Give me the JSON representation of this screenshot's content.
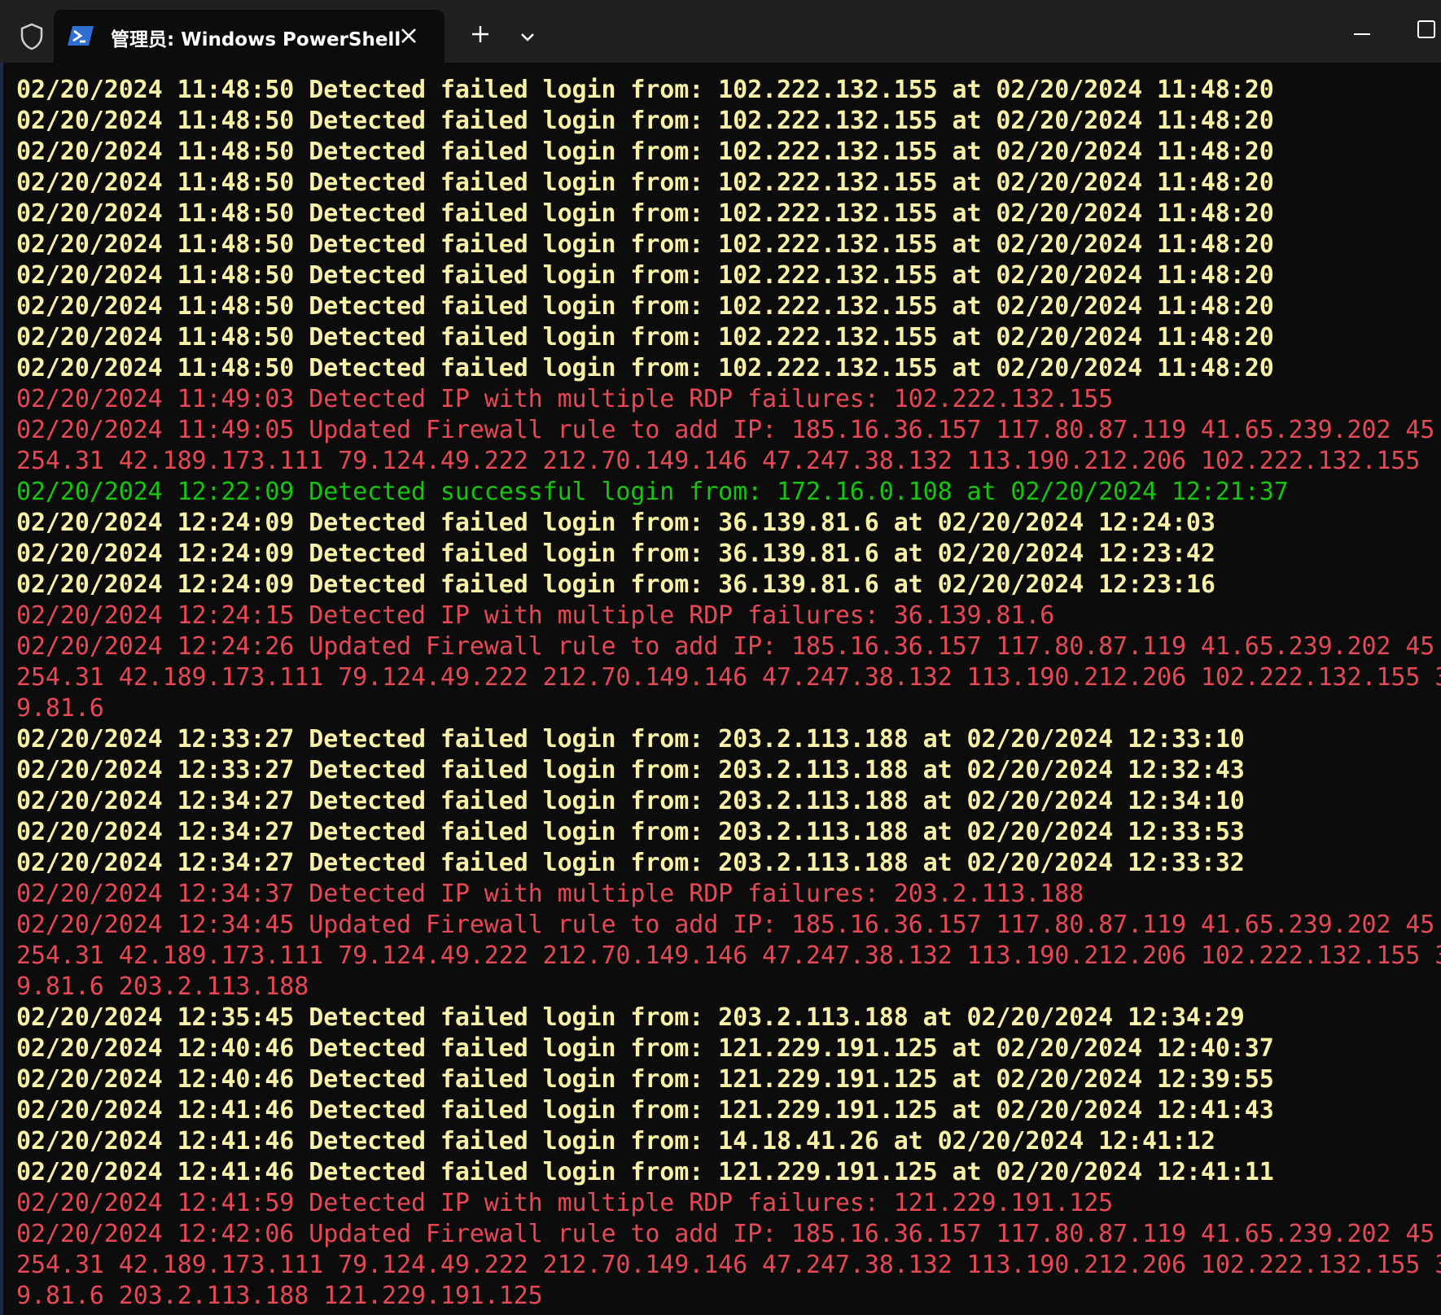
{
  "window": {
    "tab_title": "管理员: Windows PowerShell",
    "icons": {
      "shield": "shield-icon",
      "powershell": "powershell-icon",
      "close": "close-icon",
      "new_tab": "plus-icon",
      "dropdown": "chevron-down-icon",
      "minimize": "minimize-icon",
      "maximize": "maximize-icon"
    }
  },
  "colors": {
    "background": "#0c0c0c",
    "titlebar": "#202020",
    "failed": "#f9f1a5",
    "alert": "#e74856",
    "success": "#16c60c"
  },
  "terminal": {
    "lines": [
      {
        "type": "failed",
        "text": "02/20/2024 11:48:50 Detected failed login from: 102.222.132.155 at 02/20/2024 11:48:20"
      },
      {
        "type": "failed",
        "text": "02/20/2024 11:48:50 Detected failed login from: 102.222.132.155 at 02/20/2024 11:48:20"
      },
      {
        "type": "failed",
        "text": "02/20/2024 11:48:50 Detected failed login from: 102.222.132.155 at 02/20/2024 11:48:20"
      },
      {
        "type": "failed",
        "text": "02/20/2024 11:48:50 Detected failed login from: 102.222.132.155 at 02/20/2024 11:48:20"
      },
      {
        "type": "failed",
        "text": "02/20/2024 11:48:50 Detected failed login from: 102.222.132.155 at 02/20/2024 11:48:20"
      },
      {
        "type": "failed",
        "text": "02/20/2024 11:48:50 Detected failed login from: 102.222.132.155 at 02/20/2024 11:48:20"
      },
      {
        "type": "failed",
        "text": "02/20/2024 11:48:50 Detected failed login from: 102.222.132.155 at 02/20/2024 11:48:20"
      },
      {
        "type": "failed",
        "text": "02/20/2024 11:48:50 Detected failed login from: 102.222.132.155 at 02/20/2024 11:48:20"
      },
      {
        "type": "failed",
        "text": "02/20/2024 11:48:50 Detected failed login from: 102.222.132.155 at 02/20/2024 11:48:20"
      },
      {
        "type": "failed",
        "text": "02/20/2024 11:48:50 Detected failed login from: 102.222.132.155 at 02/20/2024 11:48:20"
      },
      {
        "type": "alert",
        "text": "02/20/2024 11:49:03 Detected IP with multiple RDP failures: 102.222.132.155"
      },
      {
        "type": "alert",
        "text": "02/20/2024 11:49:05 Updated Firewall rule to add IP: 185.16.36.157 117.80.87.119 41.65.239.202 45"
      },
      {
        "type": "alert",
        "text": "254.31 42.189.173.111 79.124.49.222 212.70.149.146 47.247.38.132 113.190.212.206 102.222.132.155"
      },
      {
        "type": "success",
        "text": "02/20/2024 12:22:09 Detected successful login from: 172.16.0.108 at 02/20/2024 12:21:37"
      },
      {
        "type": "failed",
        "text": "02/20/2024 12:24:09 Detected failed login from: 36.139.81.6 at 02/20/2024 12:24:03"
      },
      {
        "type": "failed",
        "text": "02/20/2024 12:24:09 Detected failed login from: 36.139.81.6 at 02/20/2024 12:23:42"
      },
      {
        "type": "failed",
        "text": "02/20/2024 12:24:09 Detected failed login from: 36.139.81.6 at 02/20/2024 12:23:16"
      },
      {
        "type": "alert",
        "text": "02/20/2024 12:24:15 Detected IP with multiple RDP failures: 36.139.81.6"
      },
      {
        "type": "alert",
        "text": "02/20/2024 12:24:26 Updated Firewall rule to add IP: 185.16.36.157 117.80.87.119 41.65.239.202 45"
      },
      {
        "type": "alert",
        "text": "254.31 42.189.173.111 79.124.49.222 212.70.149.146 47.247.38.132 113.190.212.206 102.222.132.155 3"
      },
      {
        "type": "alert",
        "text": "9.81.6"
      },
      {
        "type": "failed",
        "text": "02/20/2024 12:33:27 Detected failed login from: 203.2.113.188 at 02/20/2024 12:33:10"
      },
      {
        "type": "failed",
        "text": "02/20/2024 12:33:27 Detected failed login from: 203.2.113.188 at 02/20/2024 12:32:43"
      },
      {
        "type": "failed",
        "text": "02/20/2024 12:34:27 Detected failed login from: 203.2.113.188 at 02/20/2024 12:34:10"
      },
      {
        "type": "failed",
        "text": "02/20/2024 12:34:27 Detected failed login from: 203.2.113.188 at 02/20/2024 12:33:53"
      },
      {
        "type": "failed",
        "text": "02/20/2024 12:34:27 Detected failed login from: 203.2.113.188 at 02/20/2024 12:33:32"
      },
      {
        "type": "alert",
        "text": "02/20/2024 12:34:37 Detected IP with multiple RDP failures: 203.2.113.188"
      },
      {
        "type": "alert",
        "text": "02/20/2024 12:34:45 Updated Firewall rule to add IP: 185.16.36.157 117.80.87.119 41.65.239.202 45"
      },
      {
        "type": "alert",
        "text": "254.31 42.189.173.111 79.124.49.222 212.70.149.146 47.247.38.132 113.190.212.206 102.222.132.155 3"
      },
      {
        "type": "alert",
        "text": "9.81.6 203.2.113.188"
      },
      {
        "type": "failed",
        "text": "02/20/2024 12:35:45 Detected failed login from: 203.2.113.188 at 02/20/2024 12:34:29"
      },
      {
        "type": "failed",
        "text": "02/20/2024 12:40:46 Detected failed login from: 121.229.191.125 at 02/20/2024 12:40:37"
      },
      {
        "type": "failed",
        "text": "02/20/2024 12:40:46 Detected failed login from: 121.229.191.125 at 02/20/2024 12:39:55"
      },
      {
        "type": "failed",
        "text": "02/20/2024 12:41:46 Detected failed login from: 121.229.191.125 at 02/20/2024 12:41:43"
      },
      {
        "type": "failed",
        "text": "02/20/2024 12:41:46 Detected failed login from: 14.18.41.26 at 02/20/2024 12:41:12"
      },
      {
        "type": "failed",
        "text": "02/20/2024 12:41:46 Detected failed login from: 121.229.191.125 at 02/20/2024 12:41:11"
      },
      {
        "type": "alert",
        "text": "02/20/2024 12:41:59 Detected IP with multiple RDP failures: 121.229.191.125"
      },
      {
        "type": "alert",
        "text": "02/20/2024 12:42:06 Updated Firewall rule to add IP: 185.16.36.157 117.80.87.119 41.65.239.202 45"
      },
      {
        "type": "alert",
        "text": "254.31 42.189.173.111 79.124.49.222 212.70.149.146 47.247.38.132 113.190.212.206 102.222.132.155 3"
      },
      {
        "type": "alert",
        "text": "9.81.6 203.2.113.188 121.229.191.125"
      }
    ]
  }
}
